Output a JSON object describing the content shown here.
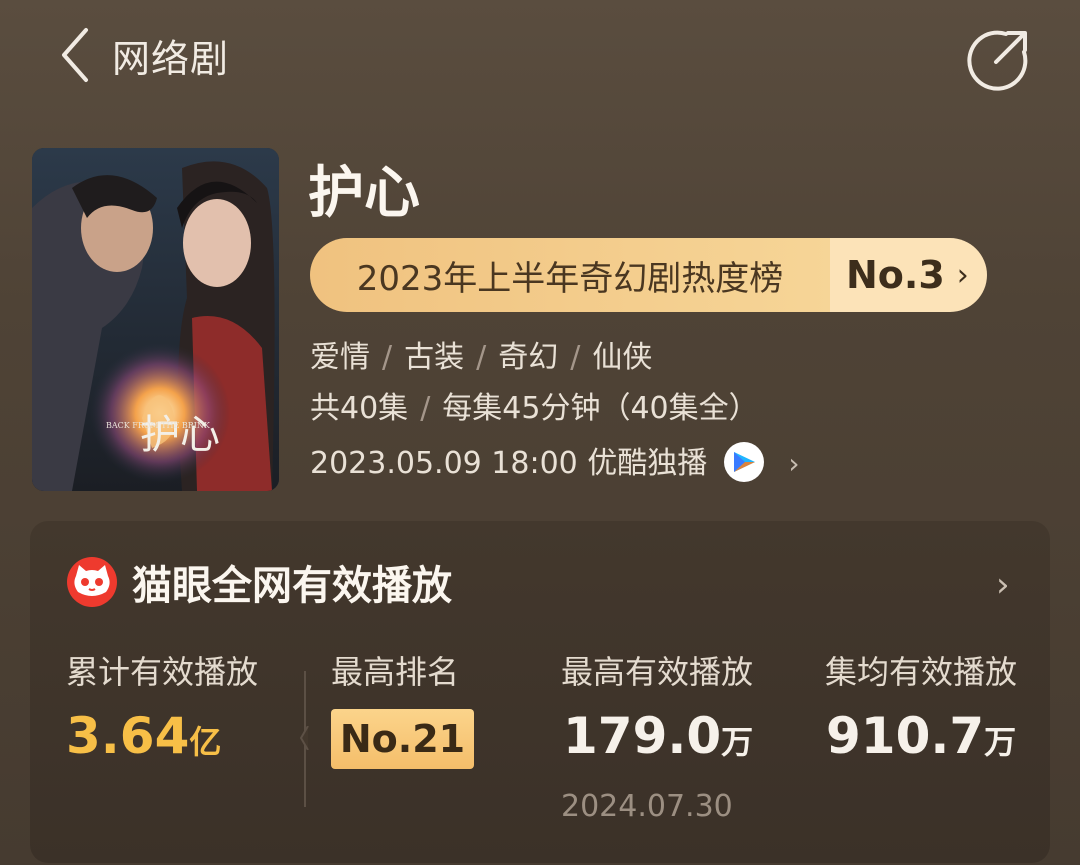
{
  "header": {
    "title": "网络剧",
    "back_icon": "chevron-left-icon",
    "share_icon": "share-icon"
  },
  "drama": {
    "title": "护心",
    "poster_text": "BACK FROM THE BRINK",
    "poster_title": "护心",
    "rank": {
      "list_name": "2023年上半年奇幻剧热度榜",
      "position": "No.3",
      "chevron": "›"
    },
    "genres": [
      "爱情",
      "古装",
      "奇幻",
      "仙侠"
    ],
    "episodes": "共40集",
    "episode_length": "每集45分钟（40集全）",
    "release": "2023.05.09 18:00 优酷独播",
    "platform_icon": "youku-icon"
  },
  "stats": {
    "title": "猫眼全网有效播放",
    "icon": "maoyan-cat-icon",
    "items": {
      "total_label": "累计有效播放",
      "total_value": "3.64",
      "total_unit": "亿",
      "best_rank_label": "最高排名",
      "best_rank_value": "No.21",
      "peak_label": "最高有效播放",
      "peak_value": "179.0",
      "peak_unit": "万",
      "peak_date": "2024.07.30",
      "avg_label": "集均有效播放",
      "avg_value": "910.7",
      "avg_unit": "万"
    }
  },
  "colors": {
    "background": "#4f4336",
    "card": "#3f342a",
    "accent_gold": "#f7bf47",
    "pill": "#f0c27f"
  }
}
